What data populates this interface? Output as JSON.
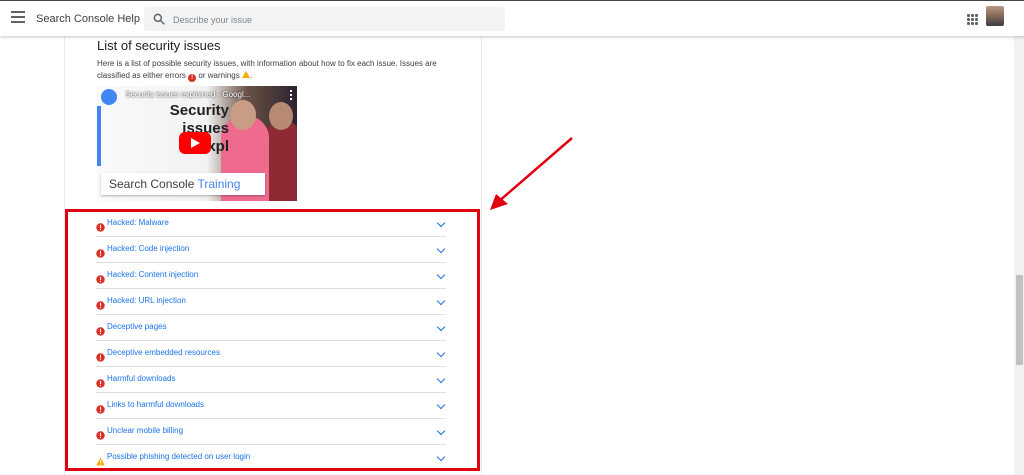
{
  "header": {
    "app_title": "Search Console Help",
    "search_placeholder": "Describe your issue",
    "search_value": ""
  },
  "section": {
    "title": "List of security issues",
    "intro_text": "Here is a list of possible security issues, with information about how to fix each issue. Issues are classified as either errors",
    "intro_or": "or warnings",
    "intro_end": "."
  },
  "video": {
    "caption": "Security issues explained - Googl...",
    "overlay_text_1": "Security",
    "overlay_text_2": "issues",
    "overlay_text_3": "expl",
    "banner_main": "Search Console ",
    "banner_accent": "Training"
  },
  "issues": [
    {
      "label": "Hacked: Malware",
      "severity": "error"
    },
    {
      "label": "Hacked: Code injection",
      "severity": "error"
    },
    {
      "label": "Hacked: Content injection",
      "severity": "error"
    },
    {
      "label": "Hacked: URL injection",
      "severity": "error"
    },
    {
      "label": "Deceptive pages",
      "severity": "error"
    },
    {
      "label": "Deceptive embedded resources",
      "severity": "error"
    },
    {
      "label": "Harmful downloads",
      "severity": "error"
    },
    {
      "label": "Links to harmful downloads",
      "severity": "error"
    },
    {
      "label": "Unclear mobile billing",
      "severity": "error"
    },
    {
      "label": "Possible phishing detected on user login",
      "severity": "warning"
    }
  ],
  "colors": {
    "link": "#1a73e8",
    "error": "#d93025",
    "warning": "#f9ab00",
    "highlight": "#e0000f"
  }
}
